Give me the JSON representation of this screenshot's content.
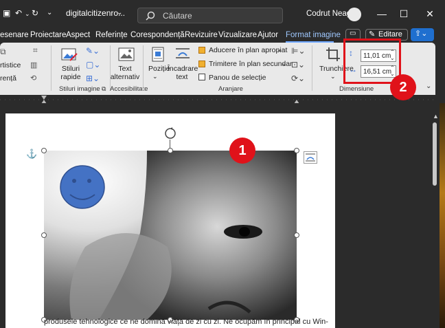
{
  "titlebar": {
    "doc_name": "digitalcitizenro...",
    "search_placeholder": "Căutare",
    "user_name": "Codrut Neagu"
  },
  "menu": {
    "items": [
      "esenare",
      "Proiectare",
      "Aspect",
      "Referințe",
      "Corespondență",
      "Revizuire",
      "Vizualizare",
      "Ajutor",
      "Format imagine"
    ],
    "editare": "Editare"
  },
  "ribbon": {
    "styles_left": [
      "rtistice",
      "rență"
    ],
    "stiluri_rapide": "Stiluri rapide",
    "stiluri_imagine": "Stiluri imagine",
    "text_alternativ": "Text alternativ",
    "accesibilitate": "Accesibilitate",
    "pozitie": "Poziție",
    "incadrare_text": "Încadrare text",
    "aducere": "Aducere în plan apropiat",
    "trimitere": "Trimitere în plan secundar",
    "panou": "Panou de selecție",
    "aranjare": "Aranjare",
    "trunchiere": "Trunchiere",
    "height_value": "11,01 cm",
    "width_value": "16,51 cm",
    "dimensiune": "Dimensiune"
  },
  "badges": [
    "1",
    "2"
  ],
  "document": {
    "bottom_line": "produsele tehnologice ce ne domină viața de zi cu zi. Ne ocupăm în principal cu Win-"
  }
}
